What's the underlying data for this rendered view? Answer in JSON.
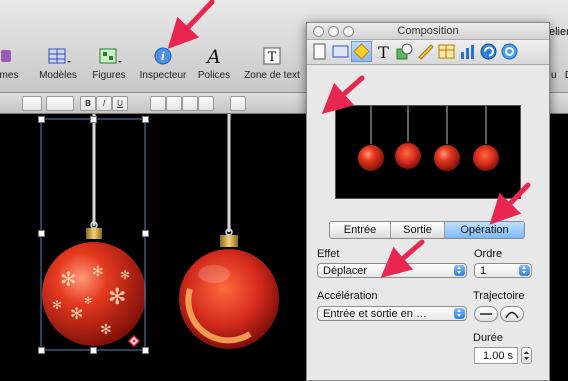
{
  "toolbar": {
    "items": [
      {
        "label": "mes",
        "icon": "themes-icon"
      },
      {
        "label": "Modèles",
        "icon": "masters-icon"
      },
      {
        "label": "Figures",
        "icon": "shapes-icon"
      },
      {
        "label": "Inspecteur",
        "icon": "inspector-icon"
      },
      {
        "label": "Polices",
        "icon": "fonts-icon"
      },
      {
        "label": "Zone de text",
        "icon": "textbox-icon"
      }
    ],
    "right_text_top": "elier",
    "right_text_bottom": "u   D",
    "font_glyph": "A",
    "textbox_glyph": "T",
    "info_glyph": "i"
  },
  "formatbar": {
    "bold": "B",
    "italic": "I",
    "underline": "U"
  },
  "inspector": {
    "title": "Composition",
    "tabs": [
      "document",
      "slide",
      "build",
      "text",
      "graphic",
      "metrics",
      "table",
      "chart",
      "hyperlink",
      "quicktime"
    ],
    "text_tab_glyph": "T",
    "active_tab": "build",
    "segments": {
      "in": "Entrée",
      "out": "Sortie",
      "action": "Opération",
      "selected": "Opération"
    },
    "effect_label": "Effet",
    "effect_value": "Déplacer",
    "order_label": "Ordre",
    "order_value": "1",
    "acceleration_label": "Accélération",
    "acceleration_value": "Entrée et sortie en …",
    "path_label": "Trajectoire",
    "duration_label": "Durée",
    "duration_value": "1.00 s"
  },
  "colors": {
    "arrow": "#e8264f",
    "ornament_red": "#d42a1d",
    "selection_blue": "#7db9f5"
  }
}
